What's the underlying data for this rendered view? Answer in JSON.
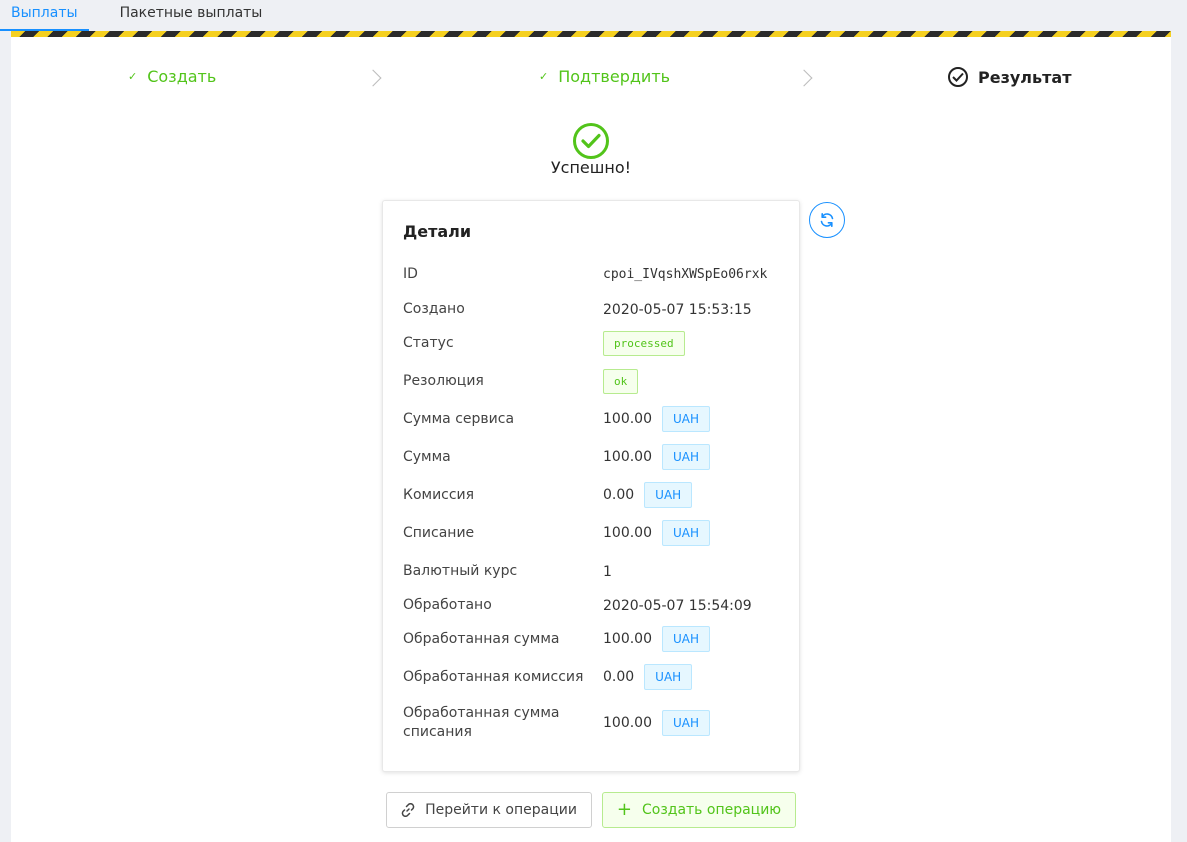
{
  "tabs": [
    {
      "label": "Выплаты",
      "active": true
    },
    {
      "label": "Пакетные выплаты",
      "active": false
    }
  ],
  "steps": [
    {
      "label": "Создать",
      "state": "done"
    },
    {
      "label": "Подтвердить",
      "state": "done"
    },
    {
      "label": "Результат",
      "state": "current"
    }
  ],
  "result": {
    "title": "Успешно!"
  },
  "details": {
    "title": "Детали",
    "id": {
      "label": "ID",
      "value": "cpoi_IVqshXWSpEo06rxk"
    },
    "created": {
      "label": "Создано",
      "value": "2020-05-07 15:53:15"
    },
    "status": {
      "label": "Статус",
      "value": "processed"
    },
    "resolution": {
      "label": "Резолюция",
      "value": "ok"
    },
    "service_amount": {
      "label": "Сумма сервиса",
      "value": "100.00",
      "currency": "UAH"
    },
    "amount": {
      "label": "Сумма",
      "value": "100.00",
      "currency": "UAH"
    },
    "commission": {
      "label": "Комиссия",
      "value": "0.00",
      "currency": "UAH"
    },
    "writeoff": {
      "label": "Списание",
      "value": "100.00",
      "currency": "UAH"
    },
    "rate": {
      "label": "Валютный курс",
      "value": "1"
    },
    "processed": {
      "label": "Обработано",
      "value": "2020-05-07 15:54:09"
    },
    "processed_amount": {
      "label": "Обработанная сумма",
      "value": "100.00",
      "currency": "UAH"
    },
    "processed_commission": {
      "label": "Обработанная комиссия",
      "value": "0.00",
      "currency": "UAH"
    },
    "processed_writeoff": {
      "label": "Обработанная сумма списания",
      "value": "100.00",
      "currency": "UAH"
    }
  },
  "actions": {
    "goto_label": "Перейти к операции",
    "create_label": "Создать операцию"
  },
  "icons": {
    "step_done": "check-icon",
    "step_current": "check-circle-icon",
    "result": "check-circle-icon",
    "refresh": "sync-icon",
    "goto": "link-icon",
    "create": "plus-icon"
  },
  "colors": {
    "primary": "#1890ff",
    "success": "#52c41a",
    "stripe_yellow": "#f5d020",
    "stripe_dark": "#2b2b2b"
  }
}
